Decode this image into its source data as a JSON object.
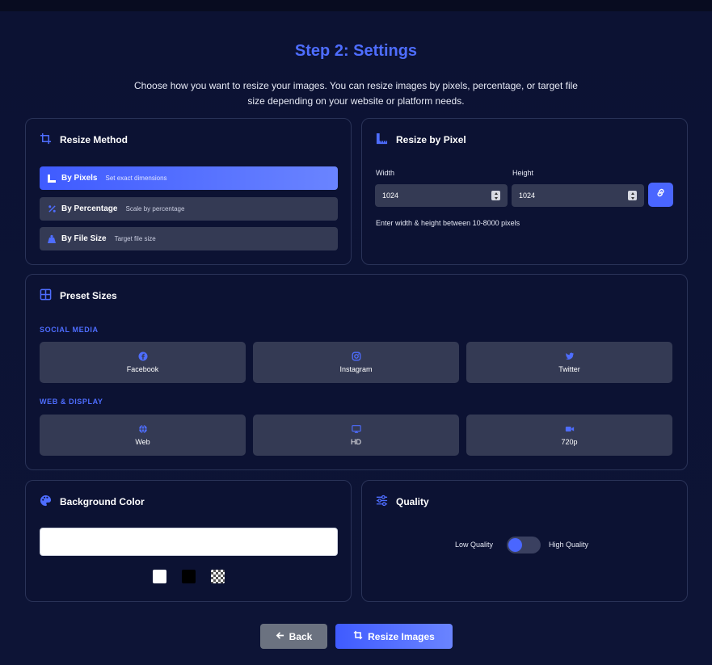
{
  "header": {
    "title": "Step 2: Settings",
    "subtitle": "Choose how you want to resize your images. You can resize images by pixels, percentage, or target file size depending on your website or platform needs."
  },
  "resize_method": {
    "title": "Resize Method",
    "icon": "crop-icon",
    "options": [
      {
        "label": "By Pixels",
        "desc": "Set exact dimensions",
        "icon": "ruler-icon",
        "active": true
      },
      {
        "label": "By Percentage",
        "desc": "Scale by percentage",
        "icon": "percent-icon",
        "active": false
      },
      {
        "label": "By File Size",
        "desc": "Target file size",
        "icon": "weight-icon",
        "active": false
      }
    ]
  },
  "resize_pixel": {
    "title": "Resize by Pixel",
    "icon": "ruler-icon",
    "width_label": "Width",
    "width_value": "1024",
    "height_label": "Height",
    "height_value": "1024",
    "hint": "Enter width & height between 10-8000 pixels",
    "link_icon": "link-icon"
  },
  "presets": {
    "title": "Preset Sizes",
    "icon": "grid-icon",
    "social_label": "SOCIAL MEDIA",
    "social": [
      {
        "label": "Facebook",
        "icon": "facebook-icon"
      },
      {
        "label": "Instagram",
        "icon": "instagram-icon"
      },
      {
        "label": "Twitter",
        "icon": "twitter-icon"
      }
    ],
    "web_label": "WEB & DISPLAY",
    "web": [
      {
        "label": "Web",
        "icon": "globe-icon"
      },
      {
        "label": "HD",
        "icon": "monitor-icon"
      },
      {
        "label": "720p",
        "icon": "video-icon"
      }
    ]
  },
  "background": {
    "title": "Background Color",
    "icon": "palette-icon",
    "value": "#ffffff",
    "swatches": [
      "#ffffff",
      "#000000",
      "transparent"
    ]
  },
  "quality": {
    "title": "Quality",
    "icon": "sliders-icon",
    "low_label": "Low Quality",
    "high_label": "High Quality",
    "high_enabled": false
  },
  "actions": {
    "back_label": "Back",
    "resize_label": "Resize Images"
  },
  "colors": {
    "accent": "#4e6dff",
    "background": "#0c1233",
    "card_border": "#2a3358",
    "control": "#343a54"
  }
}
